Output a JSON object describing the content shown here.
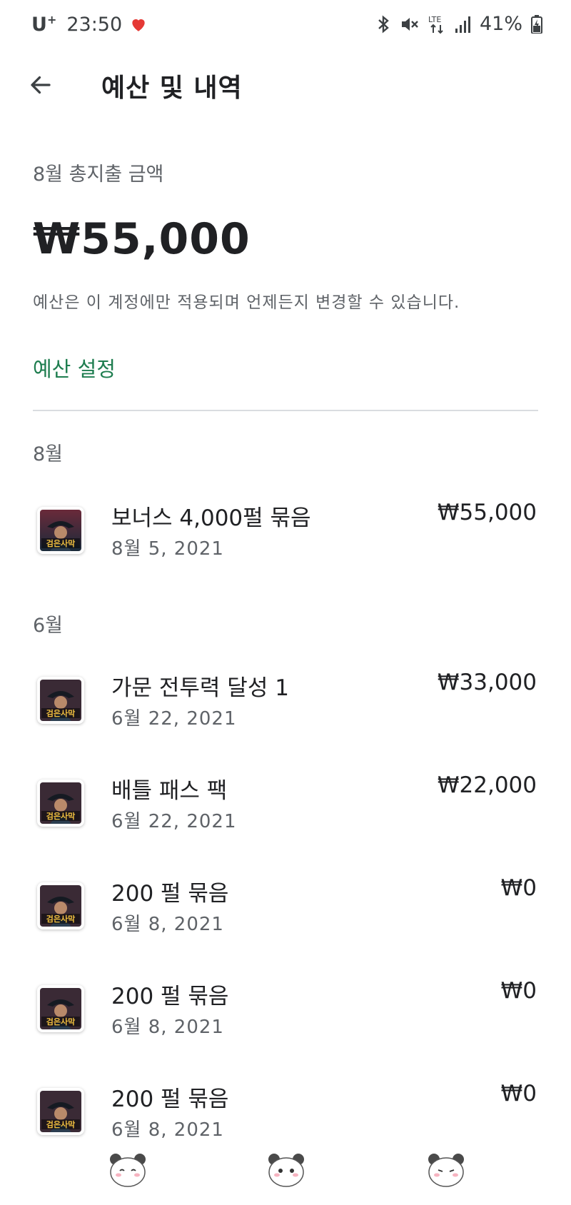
{
  "status_bar": {
    "carrier": "U",
    "carrier_sup": "+",
    "time": "23:50",
    "battery": "41%",
    "network": "LTE"
  },
  "app_bar": {
    "title": "예산 및 내역",
    "back_icon": "arrow-back-icon"
  },
  "summary": {
    "label": "8월 총지출 금액",
    "total": "₩55,000",
    "note": "예산은 이 계정에만 적용되며 언제든지 변경할 수 있습니다.",
    "budget_link": "예산 설정"
  },
  "months": [
    {
      "label": "8월",
      "transactions": [
        {
          "title": "보너스 4,000펄 묶음",
          "date": "8월 5, 2021",
          "amount": "₩55,000"
        }
      ]
    },
    {
      "label": "6월",
      "transactions": [
        {
          "title": "가문 전투력 달성 1",
          "date": "6월 22, 2021",
          "amount": "₩33,000"
        },
        {
          "title": "배틀 패스 팩",
          "date": "6월 22, 2021",
          "amount": "₩22,000"
        },
        {
          "title": "200 펄 묶음",
          "date": "6월 8, 2021",
          "amount": "₩0"
        },
        {
          "title": "200 펄 묶음",
          "date": "6월 8, 2021",
          "amount": "₩0"
        },
        {
          "title": "200 펄 묶음",
          "date": "6월 8, 2021",
          "amount": "₩0"
        }
      ]
    }
  ],
  "app_icon_text": "검은사막",
  "colors": {
    "accent_green": "#1e7d4f",
    "text_primary": "#202124",
    "text_secondary": "#5f6368",
    "heart_red": "#e53935"
  }
}
